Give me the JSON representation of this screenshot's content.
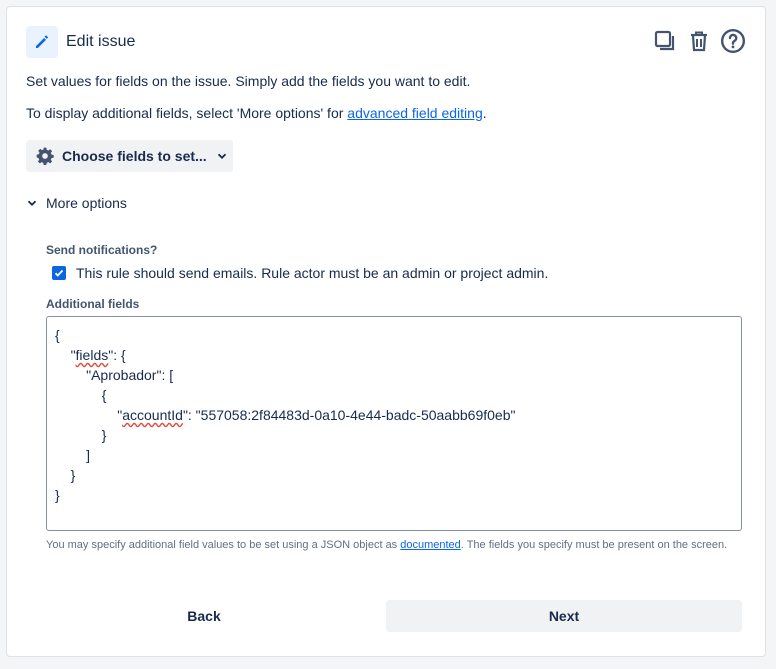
{
  "header": {
    "icon": "pencil-icon",
    "title": "Edit issue",
    "actions": [
      "duplicate-icon",
      "trash-icon",
      "help-icon"
    ],
    "accent": "#0c66e4"
  },
  "description": {
    "line1": "Set values for fields on the issue. Simply add the fields you want to edit.",
    "line2_prefix": "To display additional fields, select 'More options' for ",
    "line2_link": "advanced field editing",
    "line2_suffix": "."
  },
  "choose_fields": {
    "icon": "gear-icon",
    "label": "Choose fields to set...",
    "chevron": "chevron-down-icon"
  },
  "more_options": {
    "label": "More options",
    "expanded": true
  },
  "notifications": {
    "label": "Send notifications?",
    "checkbox_label": "This rule should send emails. Rule actor must be an admin or project admin.",
    "checked": true
  },
  "additional_fields": {
    "label": "Additional fields",
    "lines": [
      {
        "indent": "",
        "pre": "{",
        "word": "",
        "post": ""
      },
      {
        "indent": "    ",
        "pre": "\"",
        "word": "fields",
        "post": "\": {"
      },
      {
        "indent": "        ",
        "pre": "\"Aprobador\": [",
        "word": "",
        "post": ""
      },
      {
        "indent": "            ",
        "pre": "{",
        "word": "",
        "post": ""
      },
      {
        "indent": "                ",
        "pre": "\"",
        "word": "accountId",
        "post": "\": \"557058:2f84483d-0a10-4e44-badc-50aabb69f0eb\""
      },
      {
        "indent": "            ",
        "pre": "}",
        "word": "",
        "post": ""
      },
      {
        "indent": "        ",
        "pre": "]",
        "word": "",
        "post": ""
      },
      {
        "indent": "    ",
        "pre": "}",
        "word": "",
        "post": ""
      },
      {
        "indent": "",
        "pre": "}",
        "word": "",
        "post": ""
      }
    ],
    "help_prefix": "You may specify additional field values to be set using a JSON object as ",
    "help_link": "documented",
    "help_suffix": ". The fields you specify must be present on the screen."
  },
  "footer": {
    "back_label": "Back",
    "next_label": "Next"
  }
}
